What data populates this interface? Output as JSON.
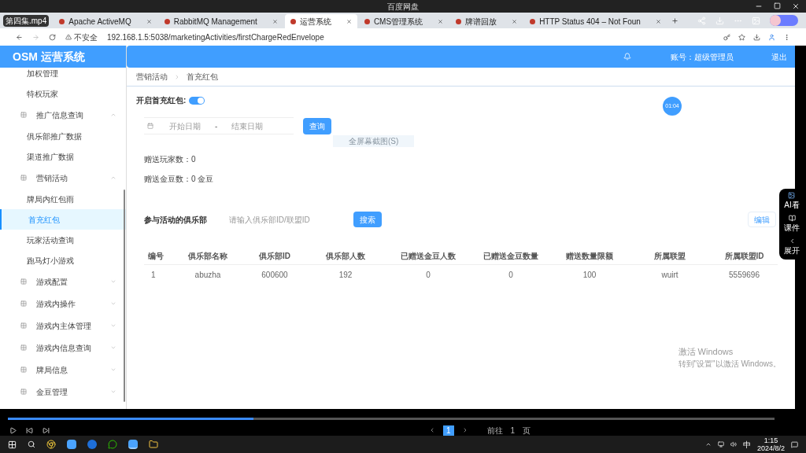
{
  "player": {
    "title": "百度网盘",
    "file_name": "第四集.mp4"
  },
  "browser": {
    "tabs": [
      {
        "label": "Apache ActiveMQ",
        "selected": false
      },
      {
        "label": "RabbitMQ Management",
        "selected": false
      },
      {
        "label": "运营系统",
        "selected": true
      },
      {
        "label": "CMS管理系统",
        "selected": false
      },
      {
        "label": "牌谱回放",
        "selected": false
      },
      {
        "label": "HTTP Status 404 – Not Foun",
        "selected": false
      }
    ],
    "security": "不安全",
    "url": "192.168.1.5:5038/marketingActivities/firstChargeRedEnvelope"
  },
  "app": {
    "logo": "OSM 运营系统",
    "account": "账号：超级管理员",
    "logout": "退出",
    "sidebar": {
      "items": [
        {
          "kind": "sub",
          "label": "加权管理",
          "selected": false
        },
        {
          "kind": "sub",
          "label": "特权玩家",
          "selected": false
        },
        {
          "kind": "group",
          "label": "推广信息查询",
          "expanded": true,
          "children": [
            {
              "label": "俱乐部推广数据",
              "selected": false
            },
            {
              "label": "渠道推广数据",
              "selected": false
            }
          ]
        },
        {
          "kind": "group",
          "label": "营销活动",
          "expanded": true,
          "children": [
            {
              "label": "牌局内红包雨",
              "selected": false
            },
            {
              "label": "首充红包",
              "selected": true
            },
            {
              "label": "玩家活动查询",
              "selected": false
            },
            {
              "label": "跑马灯小游戏",
              "selected": false
            }
          ]
        },
        {
          "kind": "group",
          "label": "游戏配置",
          "expanded": false
        },
        {
          "kind": "group",
          "label": "游戏内操作",
          "expanded": false
        },
        {
          "kind": "group",
          "label": "游戏内主体管理",
          "expanded": false
        },
        {
          "kind": "group",
          "label": "游戏内信息查询",
          "expanded": false
        },
        {
          "kind": "group",
          "label": "牌局信息",
          "expanded": false
        },
        {
          "kind": "group",
          "label": "金豆管理",
          "expanded": false
        }
      ]
    },
    "breadcrumb": [
      "营销活动",
      "首充红包"
    ],
    "toggle": {
      "label": "开启首充红包:",
      "on": true
    },
    "date_range": {
      "start_placeholder": "开始日期",
      "separator": "-",
      "end_placeholder": "结束日期"
    },
    "query_button": "查询",
    "capture_hint": "全屏幕截图(S)",
    "timer": "01:04",
    "stats": [
      "赠送玩家数：0",
      "赠送金豆数：0 金豆"
    ],
    "clubs": {
      "title": "参与活动的俱乐部",
      "search_placeholder": "请输入俱乐部ID/联盟ID",
      "search_button": "搜索",
      "edit_button": "编辑"
    },
    "table": {
      "columns": [
        "编号",
        "俱乐部名称",
        "俱乐部ID",
        "俱乐部人数",
        "已赠送金豆人数",
        "已赠送金豆数量",
        "赠送数量限额",
        "所属联盟",
        "所属联盟ID"
      ],
      "rows": [
        [
          "1",
          "abuzha",
          "600600",
          "192",
          "0",
          "0",
          "100",
          "wuirt",
          "5559696"
        ]
      ]
    },
    "pagination": {
      "page": "1",
      "goto_label": "前往",
      "goto_value": "1",
      "unit": "页"
    }
  },
  "side_panel": [
    "AI看",
    "课件",
    "展开"
  ],
  "video": {
    "progress": {
      "level": 0.32
    }
  },
  "watermark_os": [
    "激活 Windows",
    "转到\"设置\"以激活 Windows。"
  ],
  "taskbar": {
    "ime": "中",
    "time": "1:15",
    "date": "2024/8/2"
  }
}
